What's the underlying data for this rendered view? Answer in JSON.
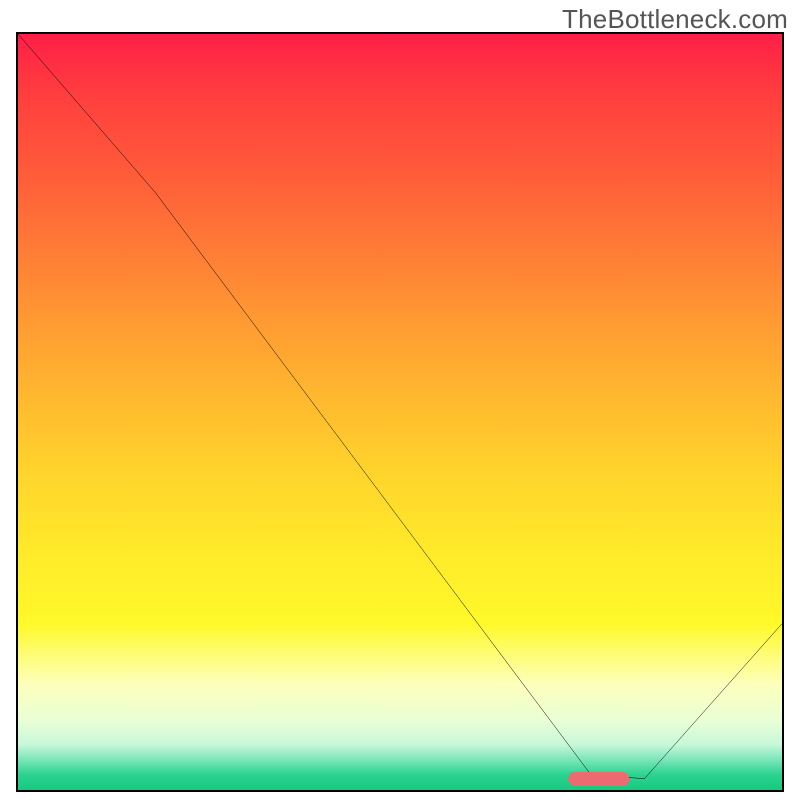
{
  "watermark": "TheBottleneck.com",
  "chart_data": {
    "type": "line",
    "title": "",
    "xlabel": "",
    "ylabel": "",
    "xlim": [
      0,
      100
    ],
    "ylim": [
      0,
      100
    ],
    "series": [
      {
        "name": "curve",
        "x": [
          0,
          18,
          75,
          82,
          100
        ],
        "values": [
          100,
          79,
          2,
          1.5,
          22
        ]
      }
    ],
    "marker": {
      "x_start": 72,
      "x_end": 80,
      "y": 1.5
    },
    "gradient_stops": [
      {
        "pos": 0,
        "color": "#ff1f47"
      },
      {
        "pos": 50,
        "color": "#ffd42c"
      },
      {
        "pos": 85,
        "color": "#fdffbc"
      },
      {
        "pos": 100,
        "color": "#17c97f"
      }
    ]
  }
}
